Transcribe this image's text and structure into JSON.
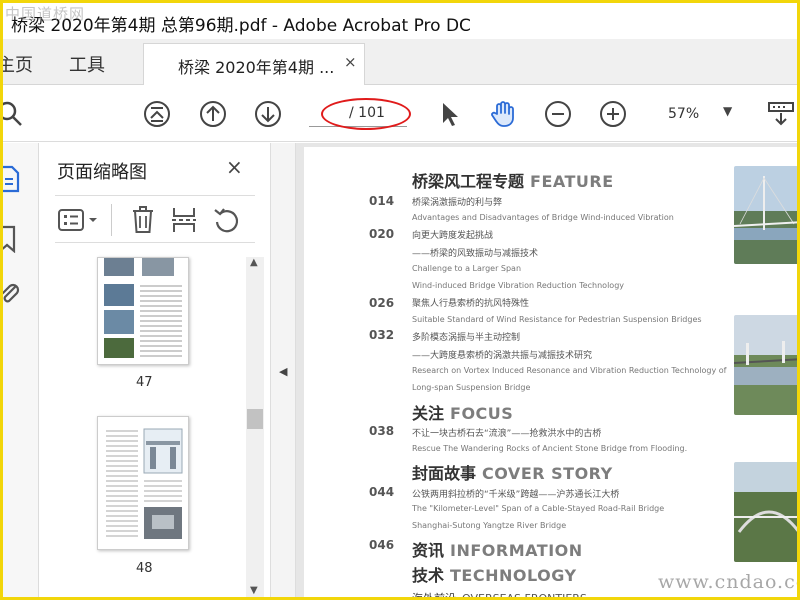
{
  "window": {
    "title": "桥梁 2020年第4期 总第96期.pdf - Adobe Acrobat Pro DC"
  },
  "watermarks": {
    "top_left": "中国道桥网",
    "bottom_right": "www.cndao.com"
  },
  "tabs": {
    "home": "主页",
    "tools": "工具",
    "document": "桥梁 2020年第4期 ...",
    "close": "×"
  },
  "toolbar": {
    "page_current": "",
    "page_total": "/ 101",
    "zoom": "57%"
  },
  "panel": {
    "title": "页面缩略图",
    "close": "×",
    "thumbnails": [
      {
        "page": "47"
      },
      {
        "page": "48"
      }
    ]
  },
  "document": {
    "sections": [
      {
        "cn": "桥梁风工程专题",
        "en": "FEATURE"
      },
      {
        "cn": "关注",
        "en": "FOCUS"
      },
      {
        "cn": "封面故事",
        "en": "COVER STORY"
      },
      {
        "cn": "资讯",
        "en": "INFORMATION"
      },
      {
        "cn": "技术",
        "en": "TECHNOLOGY"
      },
      {
        "cn": "海外前沿",
        "en": "OVERSEAS FRONTIERS"
      }
    ],
    "pages": [
      "014",
      "020",
      "026",
      "032",
      "038",
      "044",
      "046"
    ],
    "entries": [
      "桥梁涡激振动的利与弊",
      "Advantages and Disadvantages of Bridge Wind-induced Vibration",
      "向更大跨度发起挑战",
      "——桥梁的风致振动与减振技术",
      "Challenge to a Larger Span",
      "Wind-induced Bridge Vibration Reduction Technology",
      "聚焦人行悬索桥的抗风特殊性",
      "Suitable Standard of Wind Resistance for Pedestrian Suspension Bridges",
      "多阶模态涡振与半主动控制",
      "——大跨度悬索桥的涡激共振与减振技术研究",
      "Research on Vortex Induced Resonance and Vibration Reduction Technology of",
      "Long-span Suspension Bridge",
      "不让一块古桥石去“流浪”——抢救洪水中的古桥",
      "Rescue The Wandering Rocks of Ancient Stone Bridge from Flooding.",
      "公铁两用斜拉桥的“千米级”跨越——沪苏通长江大桥",
      "The \"Kilometer-Level\" Span of a Cable-Stayed Road-Rail Bridge",
      "Shanghai-Sutong Yangtze River Bridge"
    ]
  },
  "colors": {
    "accent_blue": "#2b6bd6",
    "annotation_red": "#e01b1b",
    "border_yellow": "#f2d60a"
  }
}
